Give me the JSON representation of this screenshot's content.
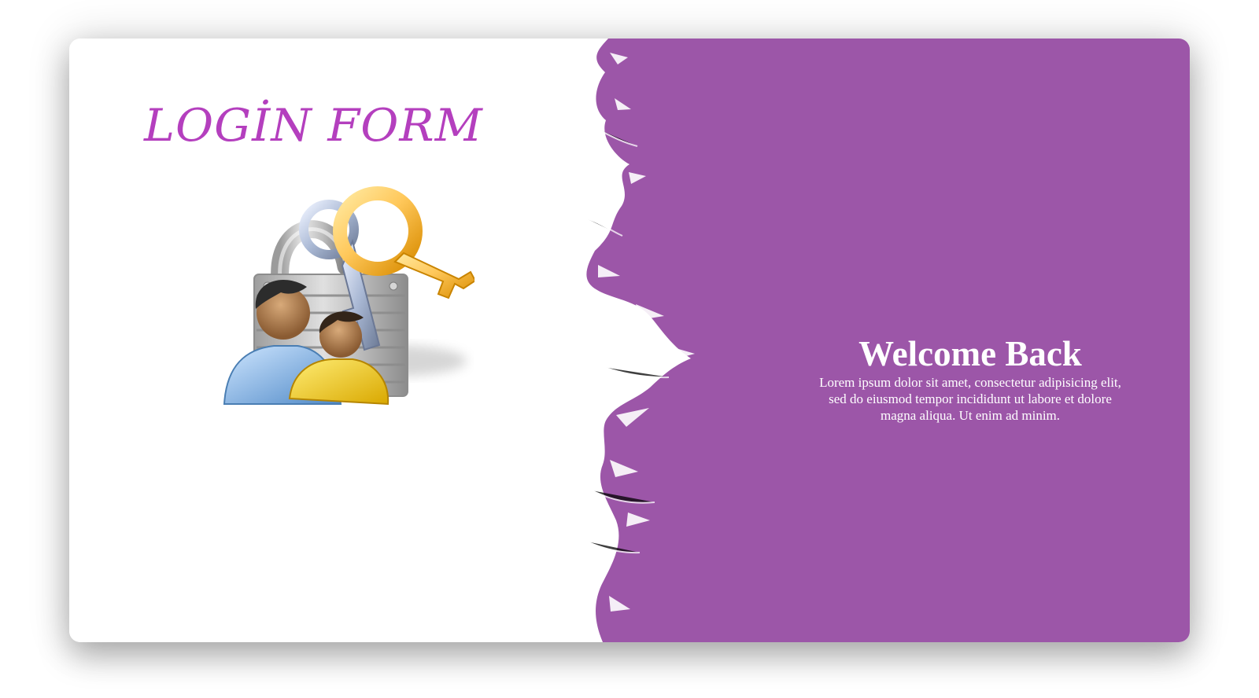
{
  "login": {
    "title": "LOGİN FORM",
    "illustration": "padlock-keys-users-icon"
  },
  "welcome": {
    "title": "Welcome Back",
    "text": "Lorem ipsum dolor sit amet, consectetur adipisicing elit, sed do eiusmod tempor incididunt ut labore et dolore magna aliqua. Ut enim ad minim."
  },
  "colors": {
    "accent_purple": "#9c56a8",
    "title_purple": "#b43fbe",
    "white": "#ffffff"
  }
}
